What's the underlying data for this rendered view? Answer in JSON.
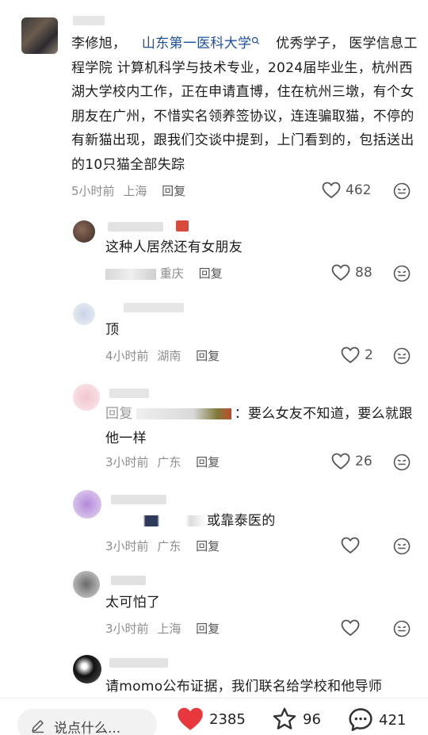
{
  "comments": [
    {
      "author_name": "李修旭，",
      "school_link": "山东第一医科大学",
      "text_after_link": "优秀学子， 医学信息工程学院 计算机科学与技术专业，2024届毕业生，杭州西湖大学校内工作，正在申请直博，住在杭州三墩，有个女朋友在广州，不惜实名领养签协议，连连骗取猫，不停的有新猫出现，跟我们交谈中提到，上门看到的，包括送出的10只猫全部失踪",
      "time": "5小时前",
      "location": "上海",
      "reply_label": "回复",
      "likes": "462"
    },
    {
      "text": "这种人居然还有女朋友",
      "time": "",
      "location": "重庆",
      "reply_label": "回复",
      "likes": "88"
    },
    {
      "text": "顶",
      "time": "4小时前",
      "location": "湖南",
      "reply_label": "回复",
      "likes": "2"
    },
    {
      "text_line1": "回复",
      "text_line1_tail": "：要么女友不知道，要么就跟",
      "text_line2": "他一样",
      "time": "3小时前",
      "location": "广东",
      "reply_label": "回复",
      "likes": "26"
    },
    {
      "text": "或靠泰医的",
      "time": "3小时前",
      "location": "广东",
      "reply_label": "回复",
      "likes": ""
    },
    {
      "text": "太可怕了",
      "time": "3小时前",
      "location": "上海",
      "reply_label": "回复",
      "likes": ""
    },
    {
      "text": "请momo公布证据，我们联名给学校和他导师"
    }
  ],
  "bottom_bar": {
    "input_placeholder": "说点什么...",
    "like_count": "2385",
    "star_count": "96",
    "comment_count": "421"
  },
  "colors": {
    "link": "#1d4f9c",
    "meta": "#8e8e8e",
    "like_heart_active": "#e8383d"
  },
  "icons": [
    "search-icon",
    "heart-icon",
    "smile-face-icon",
    "pen-icon",
    "star-icon",
    "chat-bubble-icon"
  ]
}
